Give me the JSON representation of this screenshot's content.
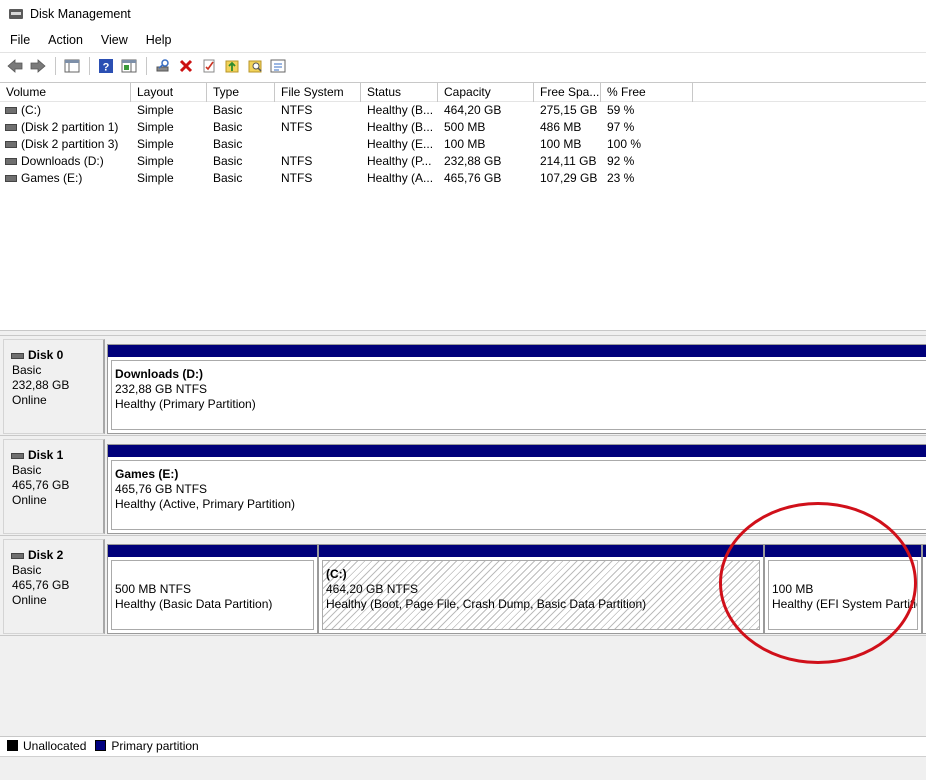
{
  "window": {
    "title": "Disk Management"
  },
  "menu": [
    "File",
    "Action",
    "View",
    "Help"
  ],
  "toolbar": [
    {
      "name": "back-arrow-icon",
      "glyph": "🡄"
    },
    {
      "name": "forward-arrow-icon",
      "glyph": "🡆"
    },
    {
      "name": "sep"
    },
    {
      "name": "show-hide-console-tree-icon",
      "glyph": "▦"
    },
    {
      "name": "sep"
    },
    {
      "name": "help-icon",
      "glyph": "?"
    },
    {
      "name": "action-pane-icon",
      "glyph": "▤"
    },
    {
      "name": "sep"
    },
    {
      "name": "connect-virtual-disk-icon",
      "glyph": "⌕"
    },
    {
      "name": "delete-icon",
      "glyph": "✖"
    },
    {
      "name": "properties-icon",
      "glyph": "☑"
    },
    {
      "name": "import-icon",
      "glyph": "⬆"
    },
    {
      "name": "search-folder-icon",
      "glyph": "⌕"
    },
    {
      "name": "settings-list-icon",
      "glyph": "☰"
    }
  ],
  "columns": [
    "Volume",
    "Layout",
    "Type",
    "File System",
    "Status",
    "Capacity",
    "Free Spa...",
    "% Free"
  ],
  "volumes": [
    {
      "volume": "(C:)",
      "layout": "Simple",
      "type": "Basic",
      "fs": "NTFS",
      "status": "Healthy (B...",
      "capacity": "464,20 GB",
      "free": "275,15 GB",
      "pct": "59 %"
    },
    {
      "volume": "(Disk 2 partition 1)",
      "layout": "Simple",
      "type": "Basic",
      "fs": "NTFS",
      "status": "Healthy (B...",
      "capacity": "500 MB",
      "free": "486 MB",
      "pct": "97 %"
    },
    {
      "volume": "(Disk 2 partition 3)",
      "layout": "Simple",
      "type": "Basic",
      "fs": "",
      "status": "Healthy (E...",
      "capacity": "100 MB",
      "free": "100 MB",
      "pct": "100 %"
    },
    {
      "volume": "Downloads (D:)",
      "layout": "Simple",
      "type": "Basic",
      "fs": "NTFS",
      "status": "Healthy (P...",
      "capacity": "232,88 GB",
      "free": "214,11 GB",
      "pct": "92 %"
    },
    {
      "volume": "Games (E:)",
      "layout": "Simple",
      "type": "Basic",
      "fs": "NTFS",
      "status": "Healthy (A...",
      "capacity": "465,76 GB",
      "free": "107,29 GB",
      "pct": "23 %"
    }
  ],
  "disks": [
    {
      "name": "Disk 0",
      "type": "Basic",
      "size": "232,88 GB",
      "state": "Online",
      "partitions": [
        {
          "name": "Downloads  (D:)",
          "size": "232,88 GB NTFS",
          "status": "Healthy (Primary Partition)"
        }
      ]
    },
    {
      "name": "Disk 1",
      "type": "Basic",
      "size": "465,76 GB",
      "state": "Online",
      "partitions": [
        {
          "name": "Games  (E:)",
          "size": "465,76 GB NTFS",
          "status": "Healthy (Active, Primary Partition)"
        }
      ]
    },
    {
      "name": "Disk 2",
      "type": "Basic",
      "size": "465,76 GB",
      "state": "Online",
      "partitions": [
        {
          "name": "",
          "size": "500 MB NTFS",
          "status": "Healthy (Basic Data Partition)"
        },
        {
          "name": "(C:)",
          "size": "464,20 GB NTFS",
          "status": "Healthy (Boot, Page File, Crash Dump, Basic Data Partition)"
        },
        {
          "name": "",
          "size": "100 MB",
          "status": "Healthy (EFI System Partitic"
        }
      ]
    }
  ],
  "legend": {
    "unallocated": "Unallocated",
    "primary": "Primary partition"
  },
  "colors": {
    "primary_partition": "#00007a",
    "annotation": "#d0101a"
  }
}
